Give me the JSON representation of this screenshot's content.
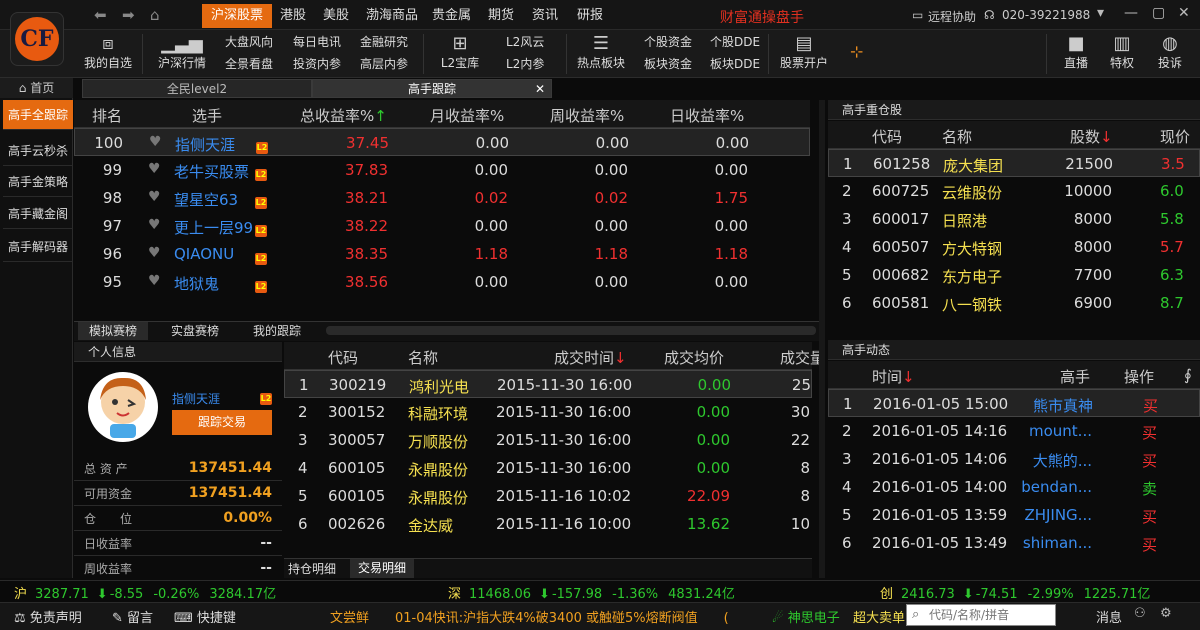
{
  "app": {
    "title": "财富通操盘手",
    "logo_letters": "CF"
  },
  "nav": {
    "back": "⬅",
    "forward": "➡",
    "home": "⌂"
  },
  "menu_tabs": [
    "沪深股票",
    "港股",
    "美股",
    "渤海商品",
    "贵金属",
    "期货",
    "资讯",
    "研报"
  ],
  "titlebar_right": {
    "remote": "远程协助",
    "phone": "020-39221988"
  },
  "toolbar": {
    "my_favorites": "我的自选",
    "sh_sz_quotes": "沪深行情",
    "links1": [
      "大盘风向",
      "全景看盘"
    ],
    "links2": [
      "每日电讯",
      "投资内参"
    ],
    "links3": [
      "金融研究",
      "高层内参"
    ],
    "l2_treasure": "L2宝库",
    "links4": [
      "L2风云",
      "L2内参"
    ],
    "hot_sector": "热点板块",
    "links5": [
      "个股资金",
      "板块资金"
    ],
    "links6": [
      "个股DDE",
      "板块DDE"
    ],
    "open_account": "股票开户",
    "live": "直播",
    "privilege": "特权",
    "complaint": "投诉"
  },
  "sidebar": {
    "home": "首页",
    "items": [
      "高手全跟踪",
      "高手云秒杀",
      "高手金策略",
      "高手藏金阁",
      "高手解码器"
    ]
  },
  "page_tabs": [
    "全民level2",
    "高手跟踪"
  ],
  "ranking": {
    "headers": [
      "排名",
      "选手",
      "总收益率%",
      "月收益率%",
      "周收益率%",
      "日收益率%"
    ],
    "sort_arrow": "↑",
    "rows": [
      {
        "rank": "100",
        "name": "指侧天涯",
        "total": "37.45",
        "month": "0.00",
        "week": "0.00",
        "day": "0.00"
      },
      {
        "rank": "99",
        "name": "老牛买股票",
        "total": "37.83",
        "month": "0.00",
        "week": "0.00",
        "day": "0.00"
      },
      {
        "rank": "98",
        "name": "望星空63",
        "total": "38.21",
        "month": "0.02",
        "week": "0.02",
        "day": "1.75"
      },
      {
        "rank": "97",
        "name": "更上一层99",
        "total": "38.22",
        "month": "0.00",
        "week": "0.00",
        "day": "0.00"
      },
      {
        "rank": "96",
        "name": "QIAONU",
        "total": "38.35",
        "month": "1.18",
        "week": "1.18",
        "day": "1.18"
      },
      {
        "rank": "95",
        "name": "地狱鬼",
        "total": "38.56",
        "month": "0.00",
        "week": "0.00",
        "day": "0.00"
      }
    ]
  },
  "bottom_tabs": [
    "模拟赛榜",
    "实盘赛榜",
    "我的跟踪"
  ],
  "profile": {
    "header": "个人信息",
    "name": "指侧天涯",
    "follow": "跟踪交易",
    "stats": [
      {
        "label": "总 资 产",
        "value": "137451.44"
      },
      {
        "label": "可用资金",
        "value": "137451.44"
      },
      {
        "label": "仓　　位",
        "value": "0.00%"
      },
      {
        "label": "日收益率",
        "value": "--"
      },
      {
        "label": "周收益率",
        "value": "--"
      }
    ]
  },
  "trades": {
    "headers": [
      "代码",
      "名称",
      "成交时间",
      "成交均价",
      "成交量"
    ],
    "sort_arrow": "↓",
    "rows": [
      {
        "no": "1",
        "code": "300219",
        "name": "鸿利光电",
        "time": "2015-11-30 16:00",
        "price": "0.00",
        "vol": "25"
      },
      {
        "no": "2",
        "code": "300152",
        "name": "科融环境",
        "time": "2015-11-30 16:00",
        "price": "0.00",
        "vol": "30"
      },
      {
        "no": "3",
        "code": "300057",
        "name": "万顺股份",
        "time": "2015-11-30 16:00",
        "price": "0.00",
        "vol": "22"
      },
      {
        "no": "4",
        "code": "600105",
        "name": "永鼎股份",
        "time": "2015-11-30 16:00",
        "price": "0.00",
        "vol": "8"
      },
      {
        "no": "5",
        "code": "600105",
        "name": "永鼎股份",
        "time": "2015-11-16 10:02",
        "price": "22.09",
        "vol": "8"
      },
      {
        "no": "6",
        "code": "002626",
        "name": "金达威",
        "time": "2015-11-16 10:00",
        "price": "13.62",
        "vol": "10"
      }
    ],
    "tabs": [
      "持仓明细",
      "交易明细"
    ]
  },
  "heavy": {
    "header": "高手重仓股",
    "headers": [
      "代码",
      "名称",
      "股数",
      "现价"
    ],
    "sort_arrow": "↓",
    "rows": [
      {
        "no": "1",
        "code": "601258",
        "name": "庞大集团",
        "shares": "21500",
        "price": "3.5"
      },
      {
        "no": "2",
        "code": "600725",
        "name": "云维股份",
        "shares": "10000",
        "price": "6.0"
      },
      {
        "no": "3",
        "code": "600017",
        "name": "日照港",
        "shares": "8000",
        "price": "5.8"
      },
      {
        "no": "4",
        "code": "600507",
        "name": "方大特钢",
        "shares": "8000",
        "price": "5.7"
      },
      {
        "no": "5",
        "code": "000682",
        "name": "东方电子",
        "shares": "7700",
        "price": "6.3"
      },
      {
        "no": "6",
        "code": "600581",
        "name": "八一钢铁",
        "shares": "6900",
        "price": "8.7"
      }
    ]
  },
  "dynamics": {
    "header": "高手动态",
    "headers": [
      "时间",
      "高手",
      "操作",
      "∮"
    ],
    "sort_arrow": "↓",
    "rows": [
      {
        "no": "1",
        "time": "2016-01-05 15:00",
        "who": "熊市真神",
        "op": "买"
      },
      {
        "no": "2",
        "time": "2016-01-05 14:16",
        "who": "mount...",
        "op": "买"
      },
      {
        "no": "3",
        "time": "2016-01-05 14:06",
        "who": "大熊的...",
        "op": "买"
      },
      {
        "no": "4",
        "time": "2016-01-05 14:00",
        "who": "bendan...",
        "op": "卖"
      },
      {
        "no": "5",
        "time": "2016-01-05 13:59",
        "who": "ZHJING...",
        "op": "买"
      },
      {
        "no": "6",
        "time": "2016-01-05 13:49",
        "who": "shiman...",
        "op": "买"
      }
    ]
  },
  "indices": [
    {
      "tag": "沪",
      "value": "3287.71",
      "change": "-8.55",
      "pct": "-0.26%",
      "amount": "3284.17亿"
    },
    {
      "tag": "深",
      "value": "11468.06",
      "change": "-157.98",
      "pct": "-1.36%",
      "amount": "4831.24亿"
    },
    {
      "tag": "创",
      "value": "2416.73",
      "change": "-74.51",
      "pct": "-2.99%",
      "amount": "1225.71亿"
    }
  ],
  "bottombar": {
    "disclaimer": "免责声明",
    "message": "留言",
    "shortcut": "快捷键",
    "ticker": "文尝鲜　　01-04快讯:沪指大跌4%破3400 或触碰5%熔断阀值　　(",
    "hot_stock": "神思电子",
    "big_sell": "超大卖单",
    "search_placeholder": "代码/名称/拼音",
    "news": "消息"
  }
}
